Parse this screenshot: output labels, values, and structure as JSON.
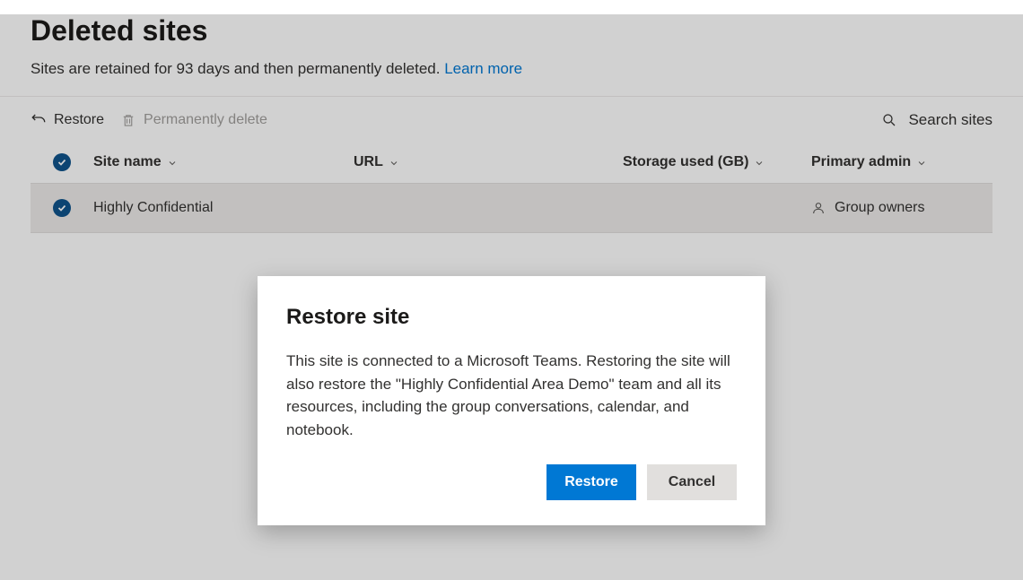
{
  "page": {
    "title": "Deleted sites",
    "subtitle_text": "Sites are retained for 93 days and then permanently deleted. ",
    "learn_more": "Learn more"
  },
  "toolbar": {
    "restore": "Restore",
    "permanently_delete": "Permanently delete",
    "search": "Search sites"
  },
  "table": {
    "columns": {
      "site_name": "Site name",
      "url": "URL",
      "storage": "Storage used (GB)",
      "primary_admin": "Primary admin"
    },
    "rows": [
      {
        "site_name": "Highly Confidential",
        "url": "",
        "storage": "",
        "primary_admin": "Group owners"
      }
    ]
  },
  "dialog": {
    "title": "Restore site",
    "body": "This site is connected to a Microsoft Teams. Restoring the site will also restore the \"Highly Confidential Area Demo\" team and all its resources, including the group conversations, calendar, and notebook.",
    "restore": "Restore",
    "cancel": "Cancel"
  }
}
